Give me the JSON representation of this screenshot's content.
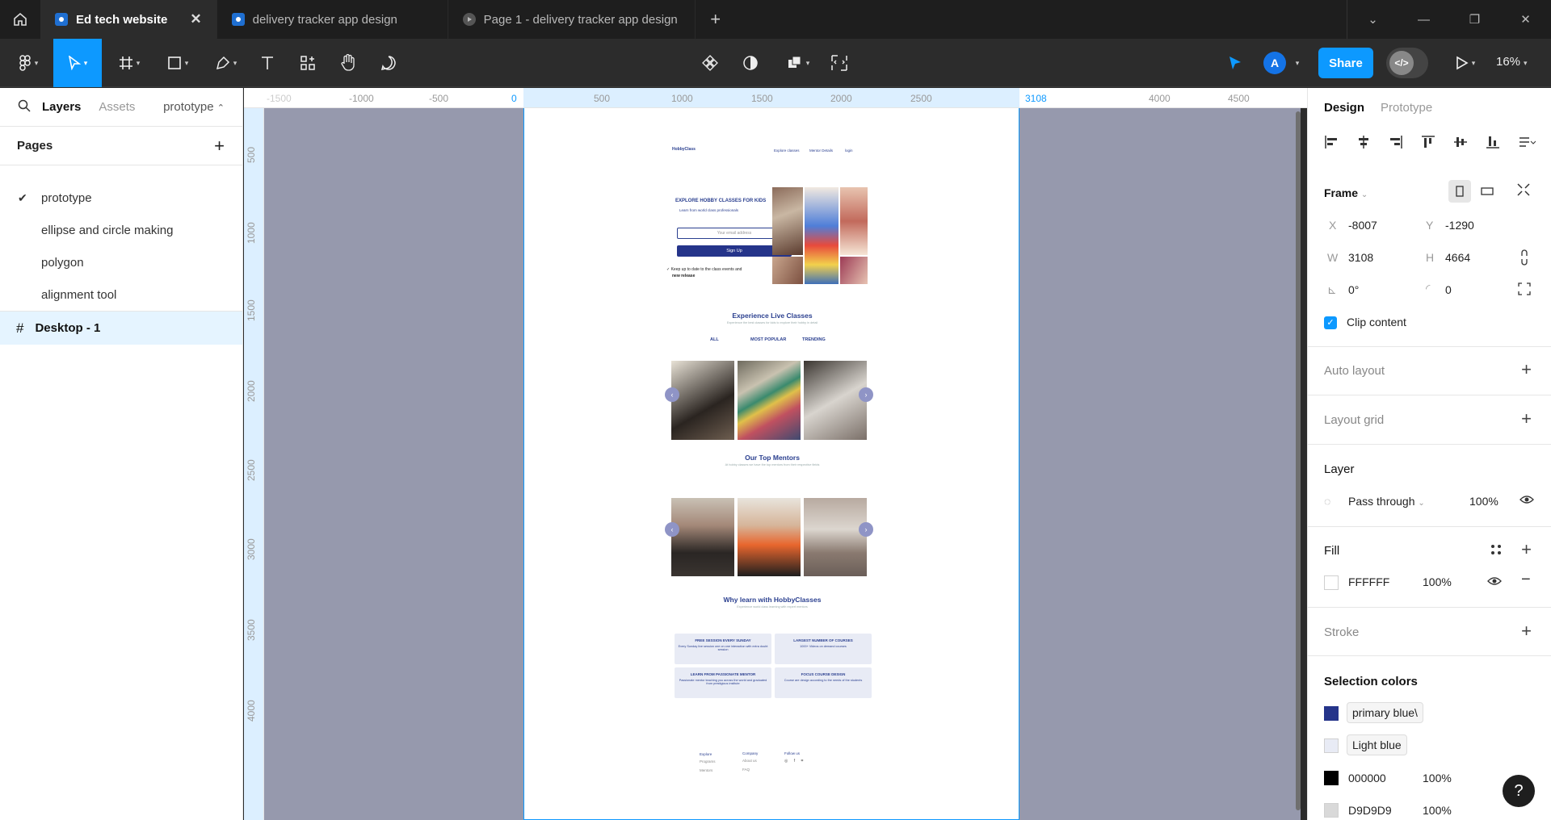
{
  "tabs": [
    {
      "label": "Ed tech website",
      "active": true
    },
    {
      "label": "delivery tracker app design",
      "active": false
    },
    {
      "label": "Page 1 - delivery tracker app design",
      "active": false
    }
  ],
  "toolbar": {
    "share_label": "Share",
    "avatar_letter": "A",
    "zoom": "16%"
  },
  "left_panel": {
    "tab_layers": "Layers",
    "tab_assets": "Assets",
    "current_page": "prototype",
    "pages_title": "Pages",
    "pages": [
      "prototype",
      "ellipse and circle making",
      "polygon",
      "alignment tool"
    ],
    "layer": "Desktop - 1"
  },
  "rulers": {
    "top": [
      "-1500",
      "-1000",
      "-500",
      "0",
      "500",
      "1000",
      "1500",
      "2000",
      "2500",
      "3108",
      "4000",
      "4500"
    ],
    "left": [
      "500",
      "1000",
      "1500",
      "2000",
      "2500",
      "3000",
      "3500",
      "4000"
    ]
  },
  "frame_content": {
    "logo": "HobbyClass",
    "nav": [
      "Explore classes",
      "Mentor Details",
      "login"
    ],
    "hero_title": "EXPLORE HOBBY CLASSES FOR KIDS",
    "hero_sub": "Learn from world class professionals",
    "email_placeholder": "Your email address",
    "signup": "Sign Up",
    "keep_up_line1": "Keep up to date to the class events and",
    "keep_up_line2": "new release",
    "live_title": "Experience Live Classes",
    "live_sub": "Experience the best classes for kids to explore their hobby in detail",
    "filters": [
      "ALL",
      "MOST POPULAR",
      "TRENDING"
    ],
    "mentors_title": "Our Top Mentors",
    "mentors_sub": "At hobby classes we have the top mentors from their respective fields",
    "why_title": "Why learn with HobbyClasses",
    "why_sub": "Experience world class learning with expert mentors",
    "features": [
      {
        "title": "FREE SESSION EVERY SUNDAY",
        "text": "Every Sunday live session one on one interaction with extra doubt session"
      },
      {
        "title": "LARGEST NUMBER OF COURSES",
        "text": "1000+ Videos on demand courses"
      },
      {
        "title": "LEARN FROM PASSIONATE MENTOR",
        "text": "Passionate mentor teaching you across the world and graduated from prestigious institute"
      },
      {
        "title": "FOCUS COURSE DESIGN",
        "text": "Course are design according to the needs of the students"
      }
    ],
    "footer_cols": [
      {
        "title": "Explore",
        "items": [
          "Programs",
          "Mentors"
        ]
      },
      {
        "title": "Company",
        "items": [
          "About us",
          "FAQ"
        ]
      },
      {
        "title": "Follow us",
        "items": []
      }
    ]
  },
  "right_panel": {
    "tab_design": "Design",
    "tab_prototype": "Prototype",
    "frame_label": "Frame",
    "x_label": "X",
    "x": "-8007",
    "y_label": "Y",
    "y": "-1290",
    "w_label": "W",
    "w": "3108",
    "h_label": "H",
    "h": "4664",
    "rotation": "0°",
    "radius": "0",
    "clip_content": "Clip content",
    "auto_layout": "Auto layout",
    "layout_grid": "Layout grid",
    "layer_title": "Layer",
    "blend": "Pass through",
    "layer_opacity": "100%",
    "fill_title": "Fill",
    "fill_hex": "FFFFFF",
    "fill_opacity": "100%",
    "stroke_title": "Stroke",
    "selection_colors_title": "Selection colors",
    "selection_colors": [
      {
        "name": "primary blue\\",
        "color": "#25348a"
      },
      {
        "name": "Light blue",
        "color": "#e8ebf5"
      },
      {
        "name": "000000",
        "opacity": "100%",
        "color": "#000000"
      },
      {
        "name": "D9D9D9",
        "opacity": "100%",
        "color": "#d9d9d9"
      }
    ]
  },
  "help": "?"
}
